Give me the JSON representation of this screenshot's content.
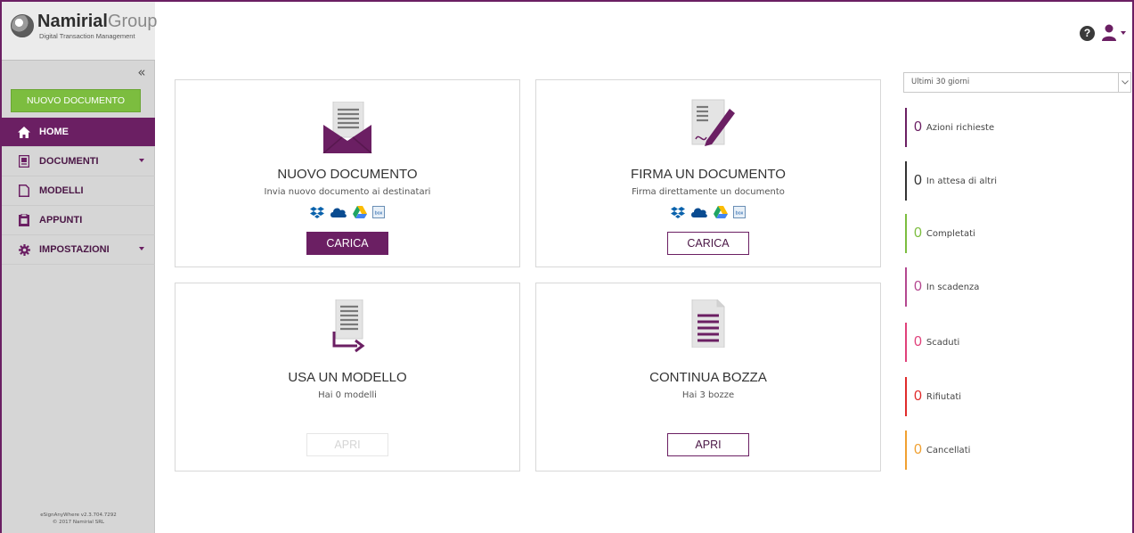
{
  "logo": {
    "brand_bold": "Namirial",
    "brand_light": "Group",
    "tagline": "Digital Transaction Management"
  },
  "sidebar": {
    "new_document_label": "NUOVO DOCUMENTO",
    "items": [
      {
        "label": "HOME",
        "icon": "home-icon",
        "active": true
      },
      {
        "label": "DOCUMENTI",
        "icon": "documents-icon",
        "dropdown": true
      },
      {
        "label": "MODELLI",
        "icon": "template-icon"
      },
      {
        "label": "APPUNTI",
        "icon": "clipboard-icon"
      },
      {
        "label": "IMPOSTAZIONI",
        "icon": "gear-icon",
        "dropdown": true
      }
    ],
    "footer_version": "eSignAnyWhere v2.3.704.7292",
    "footer_copyright": "© 2017 Namirial SRL"
  },
  "header": {
    "help_icon": "?"
  },
  "cards": {
    "new_document": {
      "title": "NUOVO DOCUMENTO",
      "subtitle": "Invia nuovo documento ai destinatari",
      "button": "CARICA"
    },
    "sign_document": {
      "title": "FIRMA UN DOCUMENTO",
      "subtitle": "Firma direttamente un documento",
      "button": "CARICA"
    },
    "use_template": {
      "title": "USA UN MODELLO",
      "subtitle": "Hai 0 modelli",
      "button": "APRI"
    },
    "continue_draft": {
      "title": "CONTINUA BOZZA",
      "subtitle": "Hai 3 bozze",
      "button": "APRI"
    }
  },
  "cloud_services": [
    "dropbox-icon",
    "onedrive-icon",
    "google-drive-icon",
    "box-icon"
  ],
  "status_panel": {
    "period": "Ultimi 30 giorni",
    "items": [
      {
        "count": "0",
        "label": "Azioni richieste",
        "color": "#6b1f63"
      },
      {
        "count": "0",
        "label": "In attesa di altri",
        "color": "#333333"
      },
      {
        "count": "0",
        "label": "Completati",
        "color": "#7cbd3f"
      },
      {
        "count": "0",
        "label": "In scadenza",
        "color": "#b4478f"
      },
      {
        "count": "0",
        "label": "Scaduti",
        "color": "#e0407a"
      },
      {
        "count": "0",
        "label": "Rifiutati",
        "color": "#e02b2b"
      },
      {
        "count": "0",
        "label": "Cancellati",
        "color": "#f0a030"
      }
    ]
  }
}
